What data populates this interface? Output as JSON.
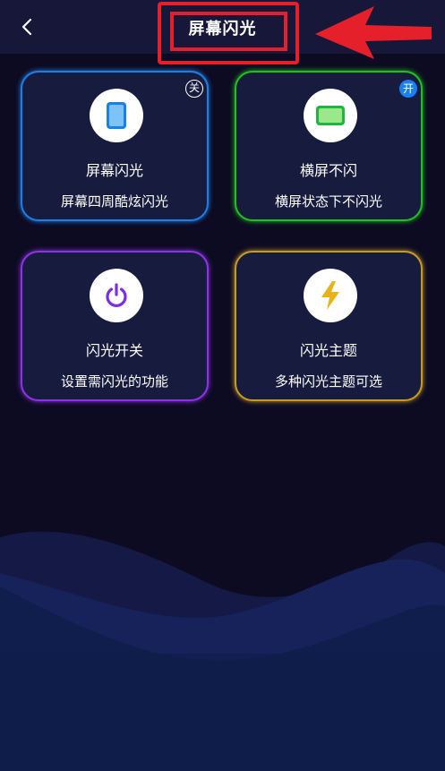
{
  "header": {
    "title": "屏幕闪光",
    "back_icon": "chevron-left-icon",
    "annotation_color": "#e5202a"
  },
  "cards": [
    {
      "title": "屏幕闪光",
      "subtitle": "屏幕四周酷炫闪光",
      "badge": "关",
      "border_color": "#1e7fe6",
      "icon": "phone-portrait-icon",
      "icon_color": "#1c7fe3"
    },
    {
      "title": "横屏不闪",
      "subtitle": "横屏状态下不闪光",
      "badge": "开",
      "border_color": "#20c11d",
      "icon": "phone-landscape-icon",
      "icon_color": "#22b43d"
    },
    {
      "title": "闪光开关",
      "subtitle": "设置需闪光的功能",
      "border_color": "#8c33e6",
      "icon": "power-icon",
      "icon_color": "#7a2ee0"
    },
    {
      "title": "闪光主题",
      "subtitle": "多种闪光主题可选",
      "border_color": "#c79b23",
      "icon": "lightning-icon",
      "icon_color": "#e8b31a"
    }
  ]
}
